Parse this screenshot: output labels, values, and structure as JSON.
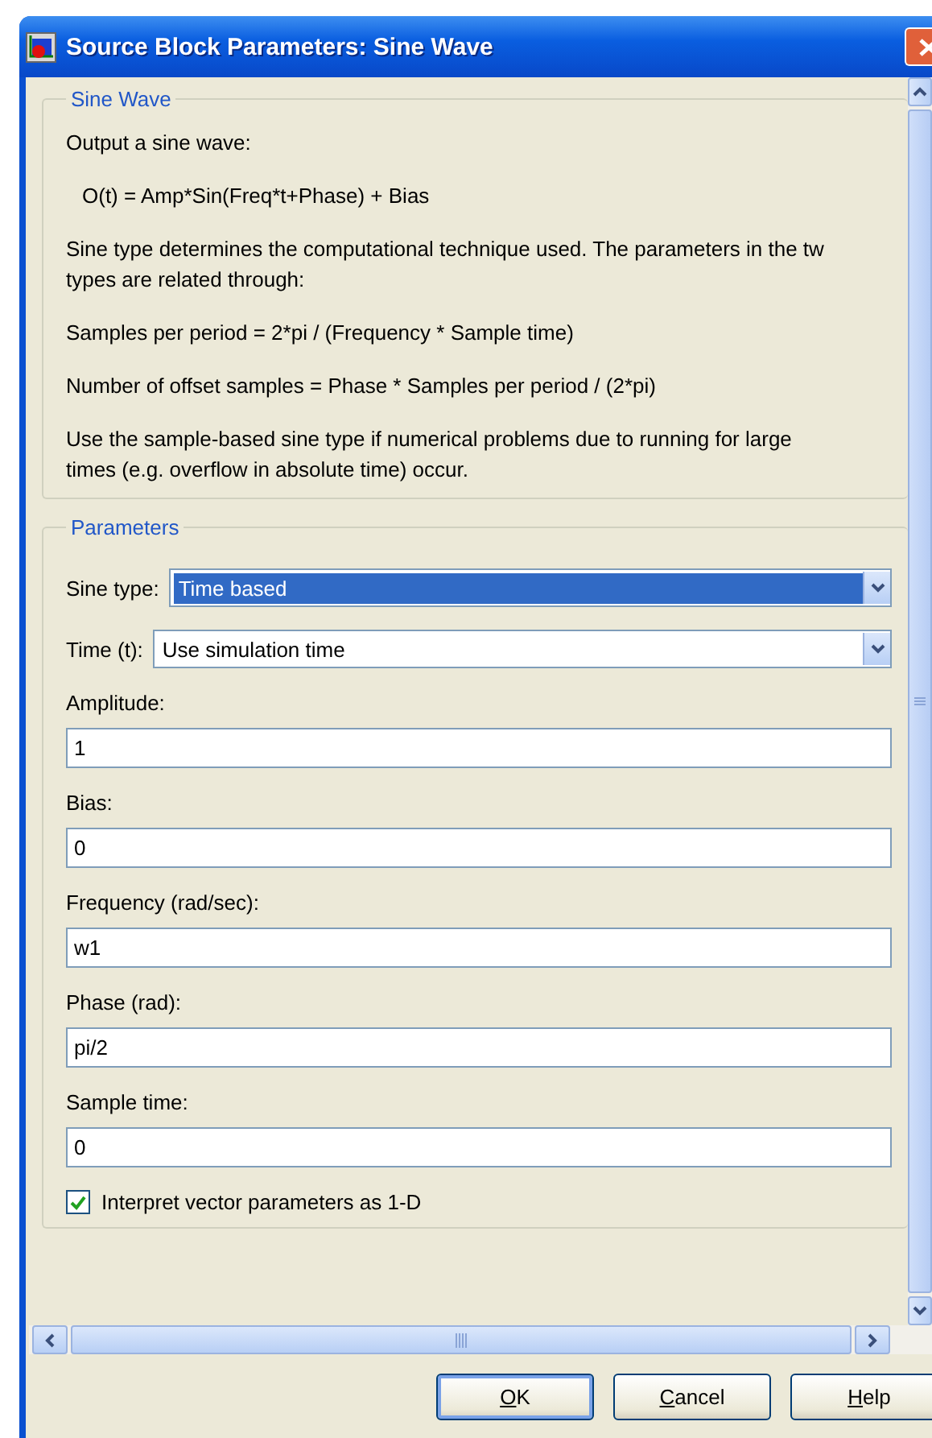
{
  "window": {
    "title": "Source Block Parameters: Sine Wave"
  },
  "description": {
    "legend": "Sine Wave",
    "paragraphs": [
      {
        "kind": "text",
        "lines": [
          "Output a sine wave:"
        ]
      },
      {
        "kind": "formula",
        "lines": [
          "O(t) = Amp*Sin(Freq*t+Phase) + Bias"
        ]
      },
      {
        "kind": "text",
        "lines": [
          "Sine type determines the computational technique used. The parameters in the tw",
          "types are related through:"
        ]
      },
      {
        "kind": "text",
        "lines": [
          "Samples per period = 2*pi / (Frequency * Sample time)"
        ]
      },
      {
        "kind": "text",
        "lines": [
          "Number of offset samples = Phase * Samples per period / (2*pi)"
        ]
      },
      {
        "kind": "text",
        "lines": [
          "Use the sample-based sine type if numerical problems due to running for large",
          "times (e.g. overflow in absolute time) occur."
        ]
      }
    ]
  },
  "parameters": {
    "legend": "Parameters",
    "items": [
      {
        "kind": "dropdown",
        "label": "Sine type:",
        "value": "Time based",
        "selected": true
      },
      {
        "kind": "dropdown",
        "label": "Time (t):",
        "value": "Use simulation time",
        "selected": false
      },
      {
        "kind": "field",
        "label": "Amplitude:",
        "value": "1"
      },
      {
        "kind": "field",
        "label": "Bias:",
        "value": "0"
      },
      {
        "kind": "field",
        "label": "Frequency (rad/sec):",
        "value": "w1"
      },
      {
        "kind": "field",
        "label": "Phase (rad):",
        "value": "pi/2"
      },
      {
        "kind": "field",
        "label": "Sample time:",
        "value": "0"
      },
      {
        "kind": "checkbox",
        "label": "Interpret vector parameters as 1-D",
        "checked": true
      }
    ]
  },
  "buttons": [
    {
      "label": "OK",
      "default": true
    },
    {
      "label": "Cancel",
      "default": false
    },
    {
      "label": "Help",
      "default": false
    }
  ]
}
